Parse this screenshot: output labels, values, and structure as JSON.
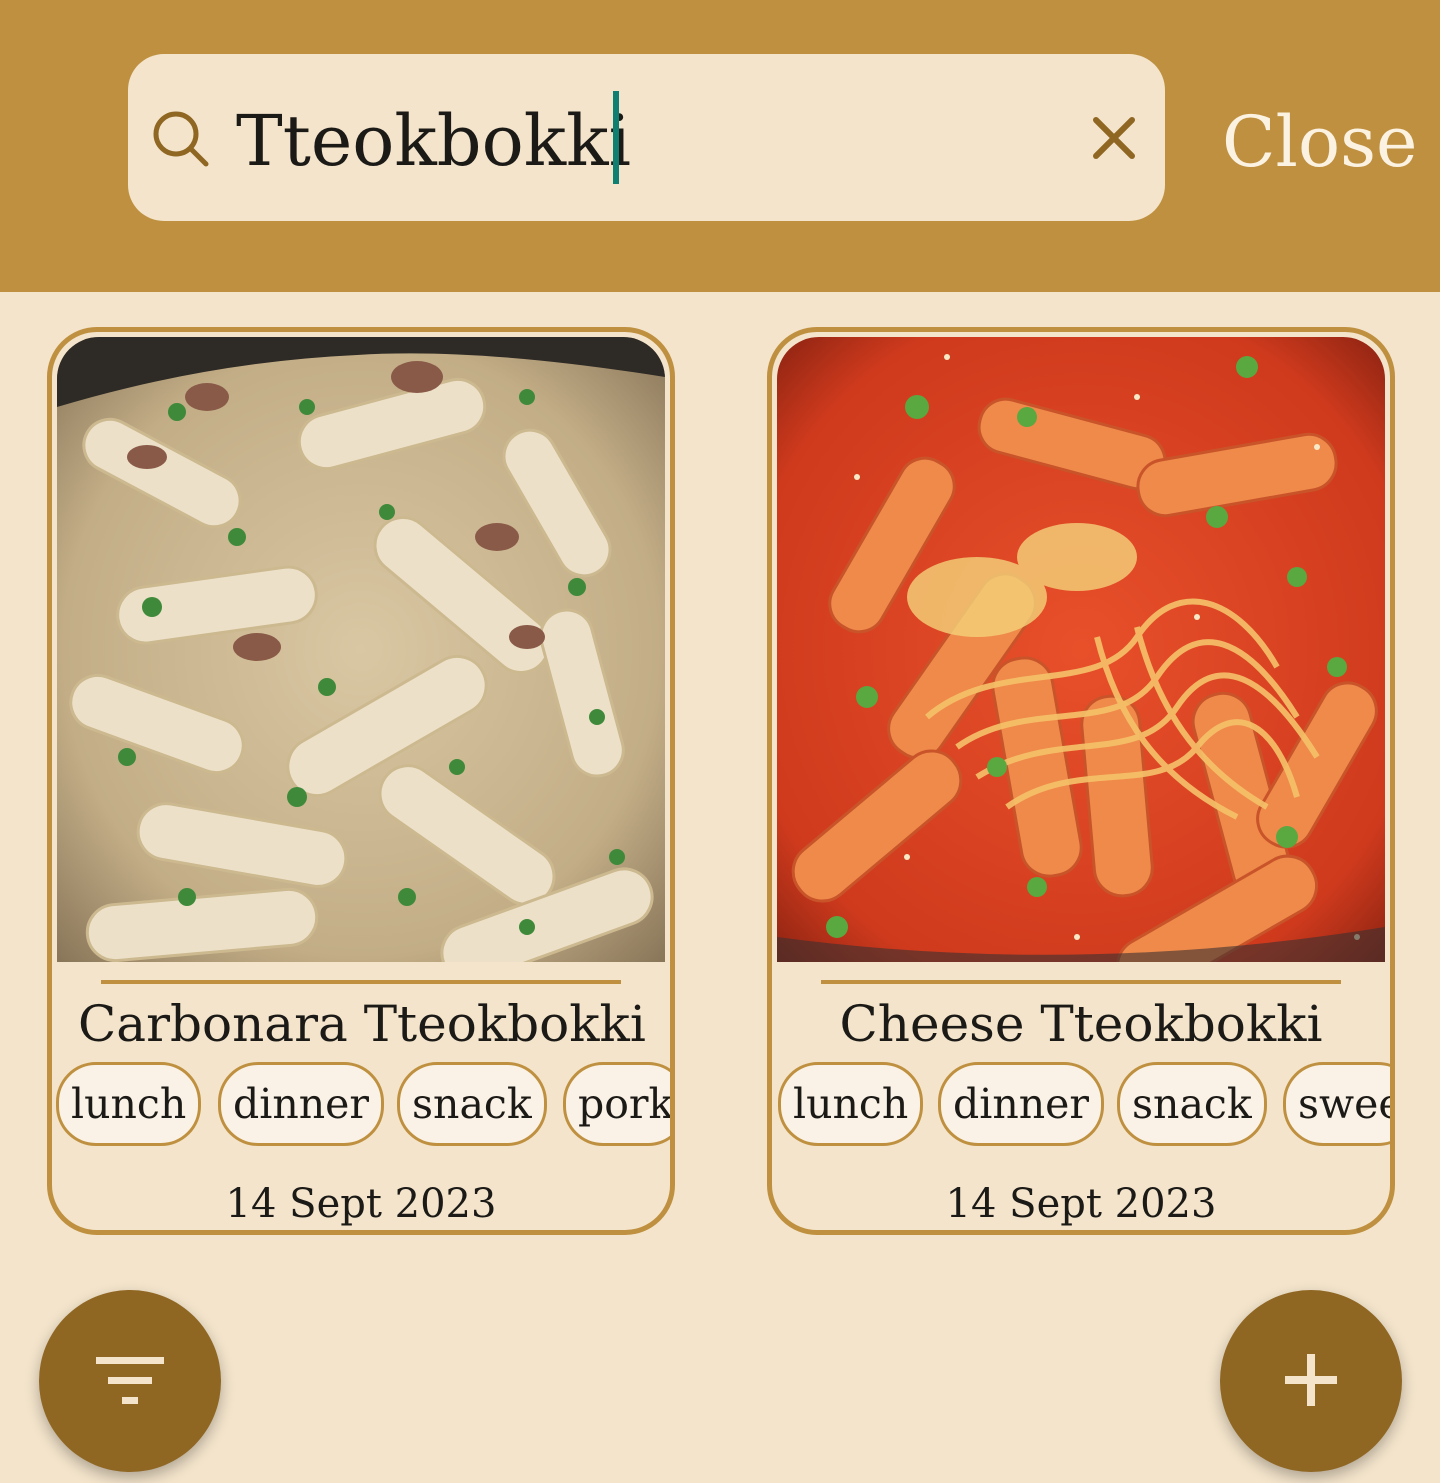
{
  "search": {
    "query": "Tteokbokki",
    "search_icon": "search-icon",
    "clear_icon": "close-icon"
  },
  "header": {
    "close_label": "Close"
  },
  "colors": {
    "header_bg": "#bf903f",
    "page_bg": "#f3e4cb",
    "accent": "#bf903f",
    "fab_bg": "#8f6622",
    "caret": "#0f7f72"
  },
  "recipes": [
    {
      "title": "Carbonara Tteokbokki",
      "tags": [
        "lunch",
        "dinner",
        "snack",
        "pork"
      ],
      "date": "14 Sept 2023"
    },
    {
      "title": "Cheese Tteokbokki",
      "tags": [
        "lunch",
        "dinner",
        "snack",
        "swee"
      ],
      "date": "14 Sept 2023"
    }
  ],
  "fabs": {
    "filter_icon": "filter-icon",
    "add_icon": "plus-icon"
  }
}
